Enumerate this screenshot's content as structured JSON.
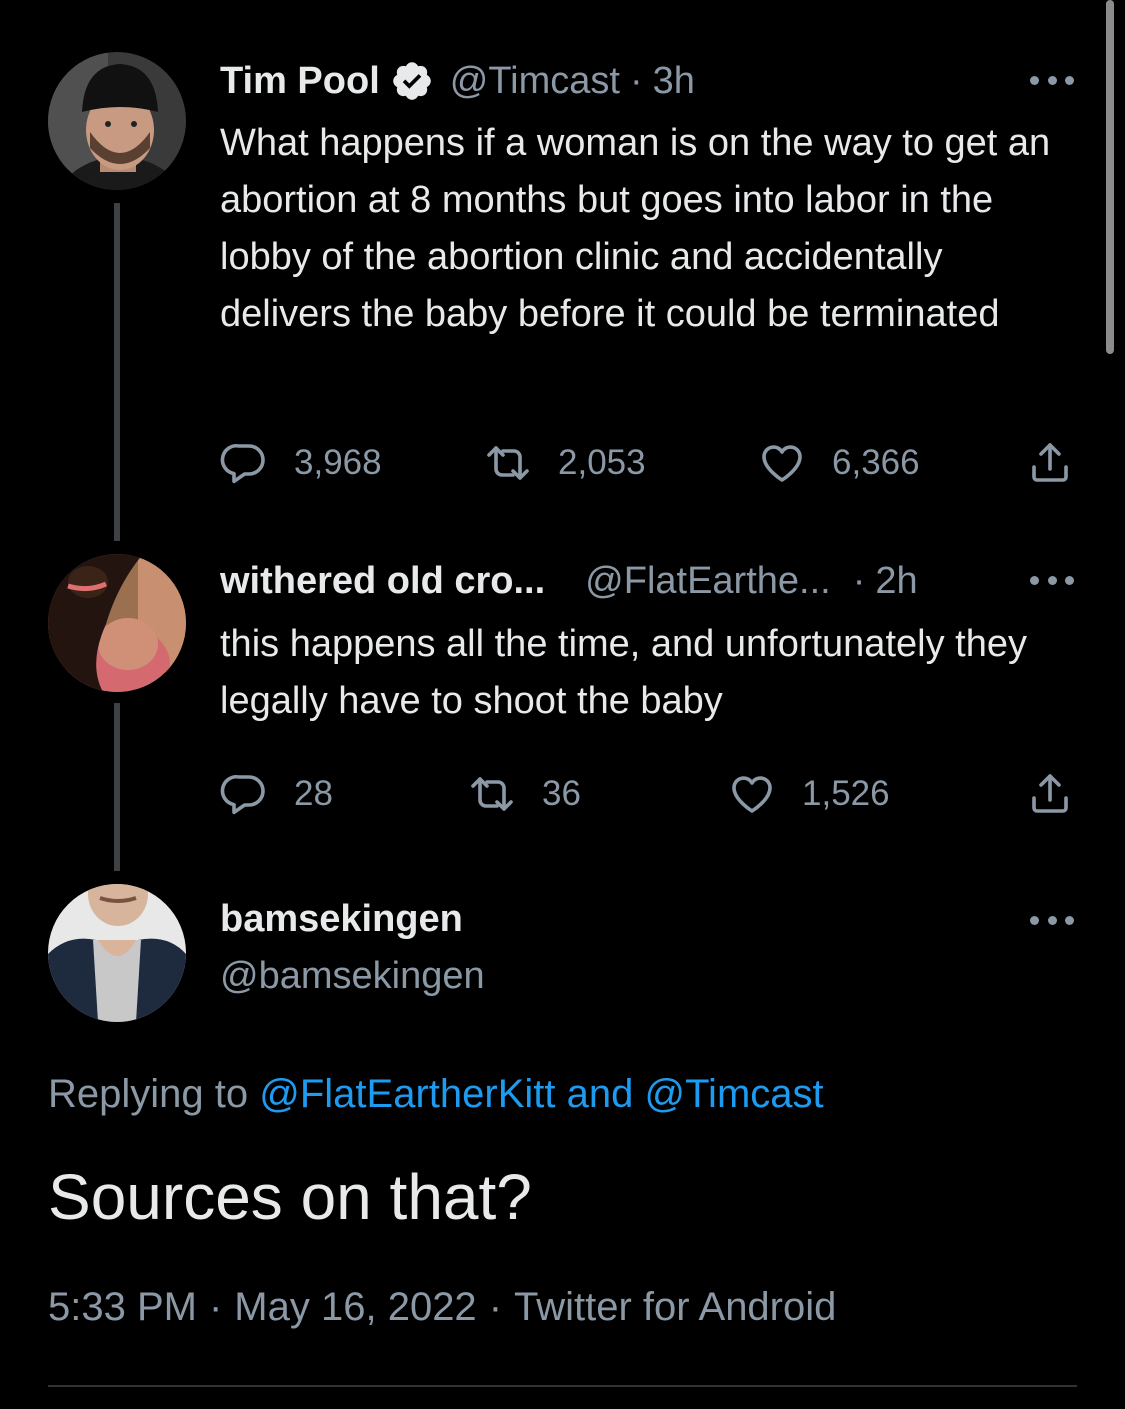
{
  "thread": [
    {
      "name": "Tim Pool",
      "verified": true,
      "handle": "@Timcast",
      "time": "3h",
      "text": "What happens if a woman is on the way to get an abortion at 8 months but goes into labor in the lobby of the abortion clinic and accidentally delivers the baby before it could be terminated",
      "replies": "3,968",
      "retweets": "2,053",
      "likes": "6,366",
      "avatar_icon": "avatar-man-beanie"
    },
    {
      "name": "withered old cro...",
      "verified": false,
      "handle": "@FlatEarthe...",
      "time": "2h",
      "text": "this happens all the time, and unfortunately they legally have to shoot the baby",
      "replies": "28",
      "retweets": "36",
      "likes": "1,526",
      "avatar_icon": "avatar-woman-dark-hair"
    }
  ],
  "focused": {
    "name": "bamsekingen",
    "handle": "@bamsekingen",
    "replying_prefix": "Replying to",
    "replying_to_1": "@FlatEartherKitt",
    "replying_and": "and",
    "replying_to_2": "@Timcast",
    "text": "Sources on that?",
    "time": "5:33 PM",
    "date": "May 16, 2022",
    "client": "Twitter for Android",
    "avatar_icon": "avatar-man-jacket"
  },
  "icons": {
    "reply": "reply-icon",
    "retweet": "retweet-icon",
    "like": "heart-icon",
    "share": "share-icon",
    "more": "more-icon",
    "verified": "verified-badge-icon"
  },
  "colors": {
    "background": "#000000",
    "text": "#e7e9ea",
    "secondary": "#8b98a5",
    "link": "#1d9bf0",
    "thread_line": "#3d4144"
  }
}
